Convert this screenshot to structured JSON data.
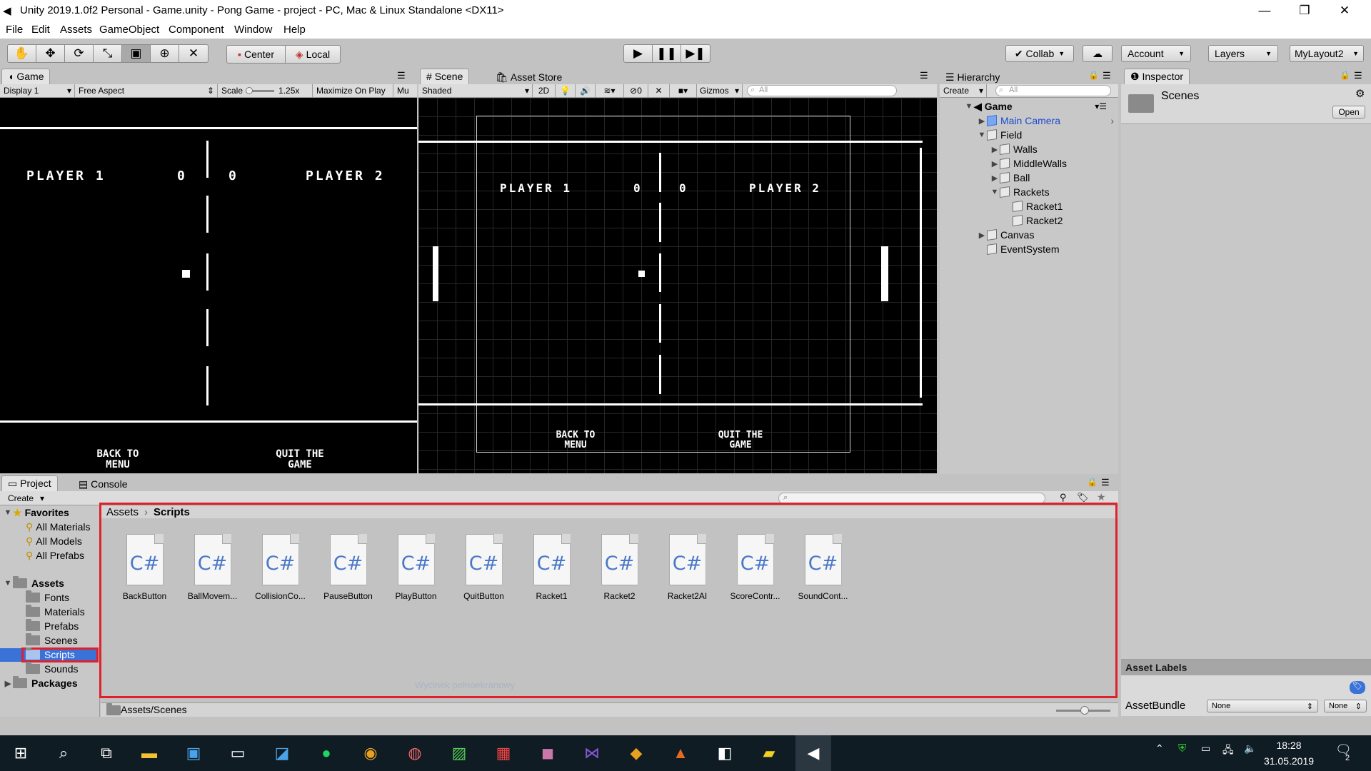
{
  "window": {
    "title": "Unity 2019.1.0f2 Personal - Game.unity - Pong Game - project - PC, Mac & Linux Standalone <DX11>",
    "minimize": "—",
    "restore": "❐",
    "close": "✕"
  },
  "menu": [
    "File",
    "Edit",
    "Assets",
    "GameObject",
    "Component",
    "Window",
    "Help"
  ],
  "toolbar": {
    "center": "Center",
    "local": "Local",
    "collab": "Collab",
    "account": "Account",
    "layers": "Layers",
    "layout": "MyLayout2"
  },
  "game": {
    "tab": "Game",
    "display": "Display 1",
    "aspect": "Free Aspect",
    "scale_label": "Scale",
    "scale_value": "1.25x",
    "maximize": "Maximize On Play",
    "mute": "Mu"
  },
  "scene": {
    "tab": "Scene",
    "store_tab": "Asset Store",
    "shaded": "Shaded",
    "mode2d": "2D",
    "hidden_count": "0",
    "gizmos": "Gizmos",
    "search_placeholder": "All"
  },
  "pong": {
    "player1": "PLAYER 1",
    "player2": "PLAYER 2",
    "score1": "0",
    "score2": "0",
    "back": "BACK TO\nMENU",
    "quit": "QUIT THE\nGAME"
  },
  "hierarchy": {
    "tab": "Hierarchy",
    "create": "Create",
    "search_placeholder": "All",
    "scene": "Game",
    "items": [
      "Main Camera",
      "Field",
      "Walls",
      "MiddleWalls",
      "Ball",
      "Rackets",
      "Racket1",
      "Racket2",
      "Canvas",
      "EventSystem"
    ]
  },
  "inspector": {
    "tab": "Inspector",
    "asset": "Scenes",
    "open": "Open",
    "labels_title": "Asset Labels",
    "bundle_label": "AssetBundle",
    "bundle_value": "None",
    "variant_value": "None"
  },
  "project": {
    "tab": "Project",
    "console_tab": "Console",
    "create": "Create",
    "favorites": "Favorites",
    "fav_items": [
      "All Materials",
      "All Models",
      "All Prefabs"
    ],
    "assets": "Assets",
    "asset_folders": [
      "Fonts",
      "Materials",
      "Prefabs",
      "Scenes",
      "Scripts",
      "Sounds"
    ],
    "packages": "Packages",
    "breadcrumb_root": "Assets",
    "breadcrumb_current": "Scripts",
    "files": [
      "BackButton",
      "BallMovem...",
      "CollisionCo...",
      "PauseButton",
      "PlayButton",
      "QuitButton",
      "Racket1",
      "Racket2",
      "Racket2AI",
      "ScoreContr...",
      "SoundCont..."
    ],
    "file_badge": "C#",
    "status_path": "Assets/Scenes",
    "watermark": "Wycinek pełnoekranowy"
  },
  "taskbar": {
    "time": "18:28",
    "date": "31.05.2019",
    "notif_count": "2"
  },
  "colors": {
    "selection": "#3a72d8",
    "highlight_box": "#e0202a",
    "hierarchy_blue": "#1a4ad0"
  }
}
